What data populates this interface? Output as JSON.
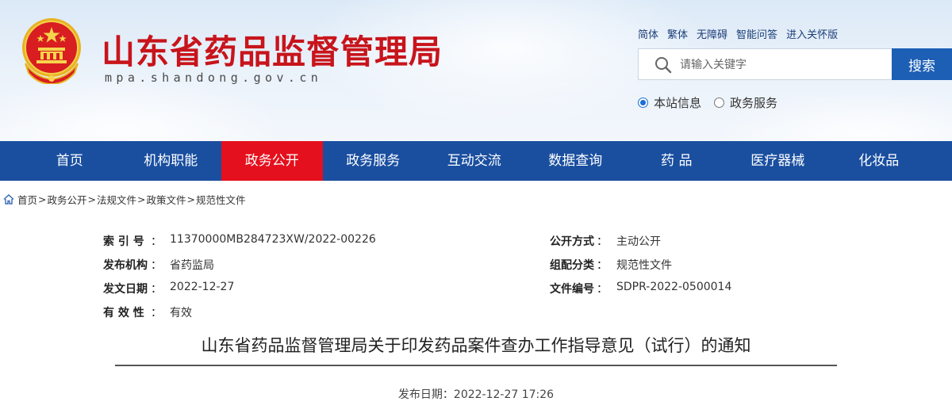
{
  "header": {
    "site_title": "山东省药品监督管理局",
    "site_domain": "mpa.shandong.gov.cn",
    "top_links": [
      "简体",
      "繁体",
      "无障碍",
      "智能问答",
      "进入关怀版"
    ],
    "search": {
      "placeholder": "请输入关键字",
      "button_label": "搜索"
    },
    "scope_options": [
      {
        "label": "本站信息",
        "checked": true
      },
      {
        "label": "政务服务",
        "checked": false
      }
    ]
  },
  "nav": {
    "items": [
      "首页",
      "机构职能",
      "政务公开",
      "政务服务",
      "互动交流",
      "数据查询",
      "药 品",
      "医疗器械",
      "化妆品"
    ],
    "active_index": 2
  },
  "breadcrumb": [
    "首页",
    "政务公开",
    "法规文件",
    "政策文件",
    "规范性文件"
  ],
  "meta": {
    "index_label": "索 引 号",
    "index_value": "11370000MB284723XW/2022-00226",
    "open_method_label": "公开方式",
    "open_method_value": "主动公开",
    "publisher_label": "发布机构",
    "publisher_value": "省药监局",
    "category_label": "组配分类",
    "category_value": "规范性文件",
    "date_label": "发文日期",
    "date_value": "2022-12-27",
    "doc_no_label": "文件编号",
    "doc_no_value": "SDPR-2022-0500014",
    "validity_label": "有 效 性",
    "validity_value": "有效",
    "colon": "："
  },
  "article": {
    "title": "山东省药品监督管理局关于印发药品案件查办工作指导意见（试行）的通知",
    "publish_date": "发布日期：2022-12-27 17:26"
  },
  "colors": {
    "brand_red": "#c8141b",
    "nav_blue": "#1a4fa0",
    "nav_active": "#e5101d",
    "search_button": "#1c5fb5"
  }
}
